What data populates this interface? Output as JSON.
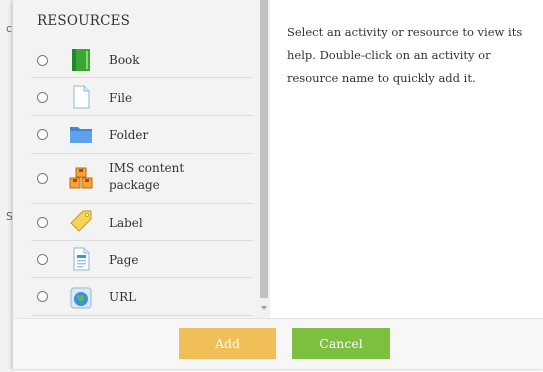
{
  "page_fragments": [
    "c",
    "S"
  ],
  "section": {
    "title": "RESOURCES"
  },
  "modules": [
    {
      "id": "book",
      "label": "Book",
      "icon": "book-icon"
    },
    {
      "id": "file",
      "label": "File",
      "icon": "file-icon"
    },
    {
      "id": "folder",
      "label": "Folder",
      "icon": "folder-icon"
    },
    {
      "id": "ims",
      "label": "IMS content package",
      "label_line1": "IMS content",
      "label_line2": "package",
      "icon": "ims-package-icon"
    },
    {
      "id": "label",
      "label": "Label",
      "icon": "tag-icon"
    },
    {
      "id": "page",
      "label": "Page",
      "icon": "page-icon"
    },
    {
      "id": "url",
      "label": "URL",
      "icon": "globe-icon"
    }
  ],
  "help": {
    "text": "Select an activity or resource to view its help. Double-click on an activity or resource name to quickly add it."
  },
  "buttons": {
    "add": "Add",
    "cancel": "Cancel"
  },
  "colors": {
    "add": "#f0bf58",
    "cancel": "#7dbf3e",
    "pane": "#f3f3f3"
  }
}
